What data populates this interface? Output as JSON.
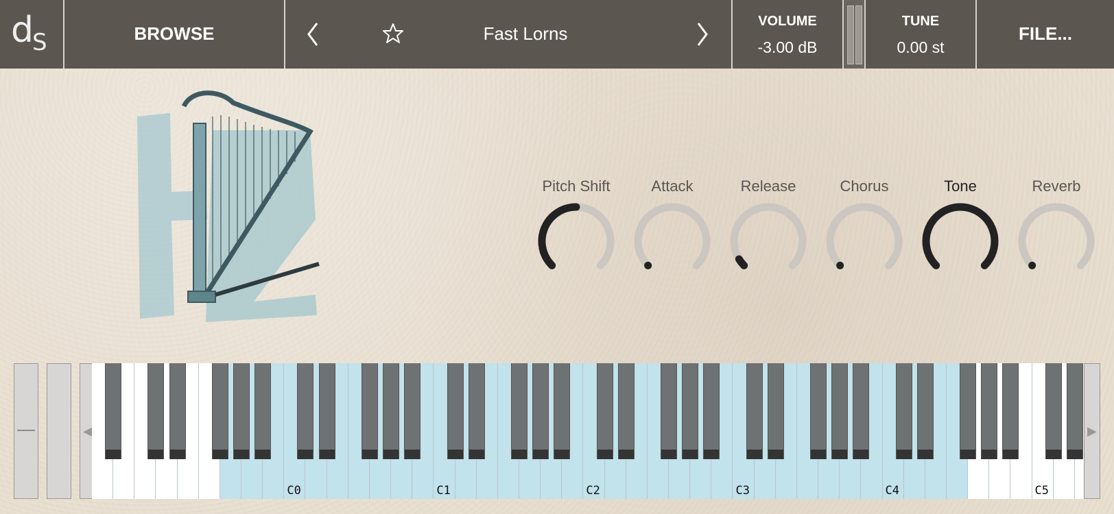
{
  "header": {
    "logo_main": "d",
    "logo_sub": "S",
    "browse_label": "BROWSE",
    "preset_name": "Fast Lorns",
    "volume_title": "VOLUME",
    "volume_value": "-3.00 dB",
    "tune_title": "TUNE",
    "tune_value": "0.00 st",
    "file_label": "FILE..."
  },
  "icons": {
    "prev": "chevron-left-icon",
    "next": "chevron-right-icon",
    "favorite": "star-icon",
    "scroll_left": "triangle-left-icon",
    "scroll_right": "triangle-right-icon"
  },
  "knobs": [
    {
      "label": "Pitch Shift",
      "value": 0.5,
      "active": false
    },
    {
      "label": "Attack",
      "value": 0.0,
      "active": false
    },
    {
      "label": "Release",
      "value": 0.05,
      "active": false
    },
    {
      "label": "Chorus",
      "value": 0.0,
      "active": false
    },
    {
      "label": "Tone",
      "value": 1.0,
      "active": true
    },
    {
      "label": "Reverb",
      "value": 0.0,
      "active": false
    }
  ],
  "keyboard": {
    "octave_labels": [
      "C0",
      "C1",
      "C2",
      "C3",
      "C4",
      "C5"
    ],
    "range_color": "#c2e2ec"
  },
  "colors": {
    "topbar": "#5b5650",
    "knob_active": "#222222",
    "knob_track": "#cbc6c0"
  }
}
